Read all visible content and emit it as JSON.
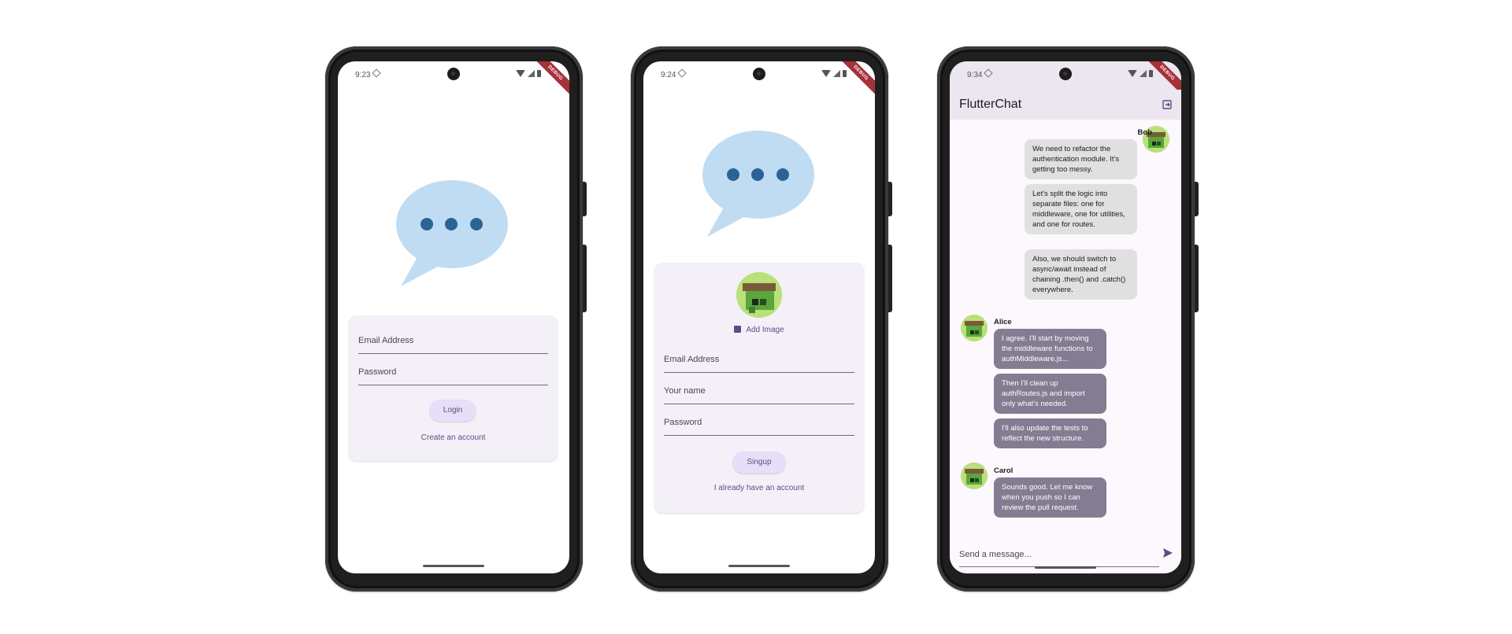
{
  "phones": [
    {
      "status_time": "9:23",
      "debug_label": "DEBUG",
      "login": {
        "email_label": "Email Address",
        "password_label": "Password",
        "login_button": "Login",
        "create_account_link": "Create an account"
      }
    },
    {
      "status_time": "9:24",
      "debug_label": "DEBUG",
      "signup": {
        "add_image_label": "Add Image",
        "email_label": "Email Address",
        "name_label": "Your name",
        "password_label": "Password",
        "signup_button": "Singup",
        "have_account_link": "I already have an account"
      }
    },
    {
      "status_time": "9:34",
      "debug_label": "DEBUG",
      "chat": {
        "app_title": "FlutterChat",
        "composer_placeholder": "Send a message...",
        "groups": [
          {
            "user": "Bob",
            "side": "right",
            "messages": [
              "We need to refactor the authentication module. It's getting too messy.",
              "Let's split the logic into separate files: one for middleware, one for utilities, and one for routes.",
              "Also, we should switch to async/await instead of chaining .then() and .catch() everywhere."
            ]
          },
          {
            "user": "Alice",
            "side": "left",
            "messages": [
              "I agree. I'll start by moving the middleware functions to authMiddleware.js...",
              "Then I'll clean up authRoutes.js and import only what's needed.",
              "I'll also update the tests to reflect the new structure."
            ]
          },
          {
            "user": "Carol",
            "side": "left",
            "messages": [
              "Sounds good. Let me know when you push so I can review the pull request."
            ]
          }
        ]
      }
    }
  ],
  "colors": {
    "bubble_light": "#bfdcf2",
    "bubble_dots": "#2b6396",
    "card_bg": "#f4f0f7",
    "button_bg": "#e8def8",
    "accent": "#5b4d86",
    "my_message_bg": "#e0e0e0",
    "other_message_bg": "#847c92",
    "appbar_bg": "#ece6f0"
  }
}
